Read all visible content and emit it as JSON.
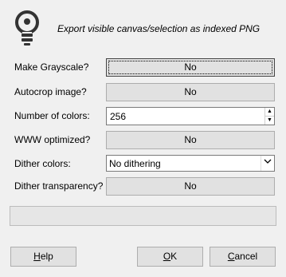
{
  "header": {
    "title": "Export visible canvas/selection as indexed PNG",
    "icon": "lightbulb-icon"
  },
  "fields": {
    "grayscale": {
      "label": "Make Grayscale?",
      "value": "No"
    },
    "autocrop": {
      "label": "Autocrop image?",
      "value": "No"
    },
    "num_colors": {
      "label": "Number of colors:",
      "value": "256"
    },
    "www": {
      "label": "WWW optimized?",
      "value": "No"
    },
    "dither": {
      "label": "Dither colors:",
      "value": "No dithering"
    },
    "dither_transparency": {
      "label": "Dither transparency?",
      "value": "No"
    }
  },
  "progress": {
    "fraction": 0
  },
  "buttons": {
    "help_mnemonic": "H",
    "help_rest": "elp",
    "ok_mnemonic": "O",
    "ok_rest": "K",
    "cancel_mnemonic": "C",
    "cancel_rest": "ancel"
  }
}
